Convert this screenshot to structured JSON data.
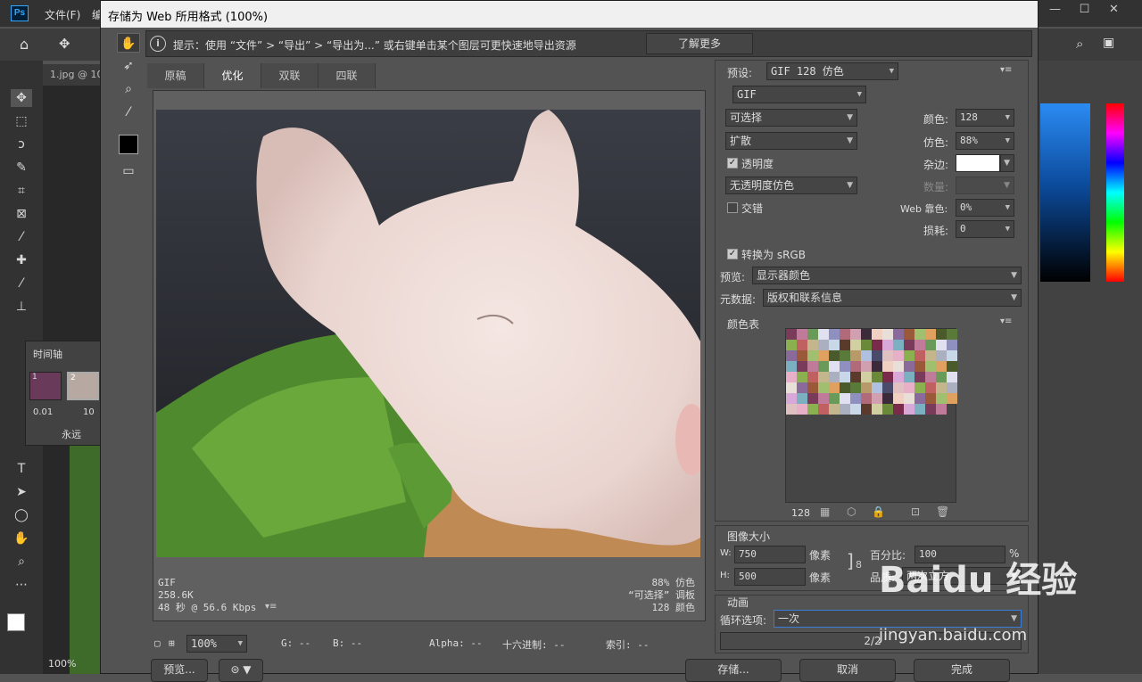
{
  "ps": {
    "logo": "Ps",
    "menus": [
      "文件(F)",
      "编"
    ],
    "doc_tab": "1.jpg @ 10",
    "timeline": {
      "title": "时间轴",
      "frame1_no": "1",
      "frame2_no": "2",
      "frame1_delay": "0.01",
      "frame2_delay": "10",
      "loop": "永远"
    },
    "zoom_bottom": "100%",
    "window_buttons": [
      "—",
      "☐",
      "✕"
    ]
  },
  "dialog": {
    "title": "存储为 Web 所用格式 (100%)",
    "hint": "提示：使用 “文件” > “导出” > “导出为...” 或右键单击某个图层可更快速地导出资源",
    "learn_more": "了解更多",
    "tabs": [
      "原稿",
      "优化",
      "双联",
      "四联"
    ],
    "active_tab": "优化",
    "info_left": [
      "GIF",
      "258.6K",
      "48 秒 @ 56.6 Kbps"
    ],
    "info_right": [
      "88% 仿色",
      "“可选择” 调板",
      "128 颜色"
    ],
    "status": {
      "zoom": "100%",
      "r": "R: --",
      "g": "G: --",
      "b": "B: --",
      "alpha": "Alpha: --",
      "hex": "十六进制: --",
      "index": "索引: --"
    },
    "settings": {
      "preset_label": "预设:",
      "preset": "GIF 128 仿色",
      "format": "GIF",
      "reduction": "可选择",
      "dither_algo": "扩散",
      "transparency_label": "透明度",
      "transparency_dither": "无透明度仿色",
      "interlaced_label": "交错",
      "colors_label": "颜色:",
      "colors": "128",
      "dither_label": "仿色:",
      "dither": "88%",
      "matte_label": "杂边:",
      "amount_label": "数量:",
      "websnap_label": "Web 靠色:",
      "websnap": "0%",
      "lossy_label": "损耗:",
      "lossy": "0",
      "srgb_label": "转换为 sRGB",
      "preview_label": "预览:",
      "preview": "显示器颜色",
      "metadata_label": "元数据:",
      "metadata": "版权和联系信息"
    },
    "color_table": {
      "title": "颜色表",
      "count": "128"
    },
    "image_size": {
      "title": "图像大小",
      "w_label": "W:",
      "w": "750",
      "h_label": "H:",
      "h": "500",
      "unit": "像素",
      "percent_label": "百分比:",
      "percent": "100",
      "pct": "%",
      "quality_label": "品质:",
      "quality": "两次立方"
    },
    "animation": {
      "title": "动画",
      "loop_label": "循环选项:",
      "loop": "一次",
      "frames": "2/2"
    },
    "buttons": {
      "preview": "预览...",
      "save": "存储...",
      "cancel": "取消",
      "done": "完成"
    }
  },
  "watermark": {
    "main": "Baidu 经验",
    "sub": "jingyan.baidu.com"
  },
  "colors": {
    "accent": "#31a8ff",
    "dialog_bg": "#535353",
    "panel": "#454545"
  }
}
